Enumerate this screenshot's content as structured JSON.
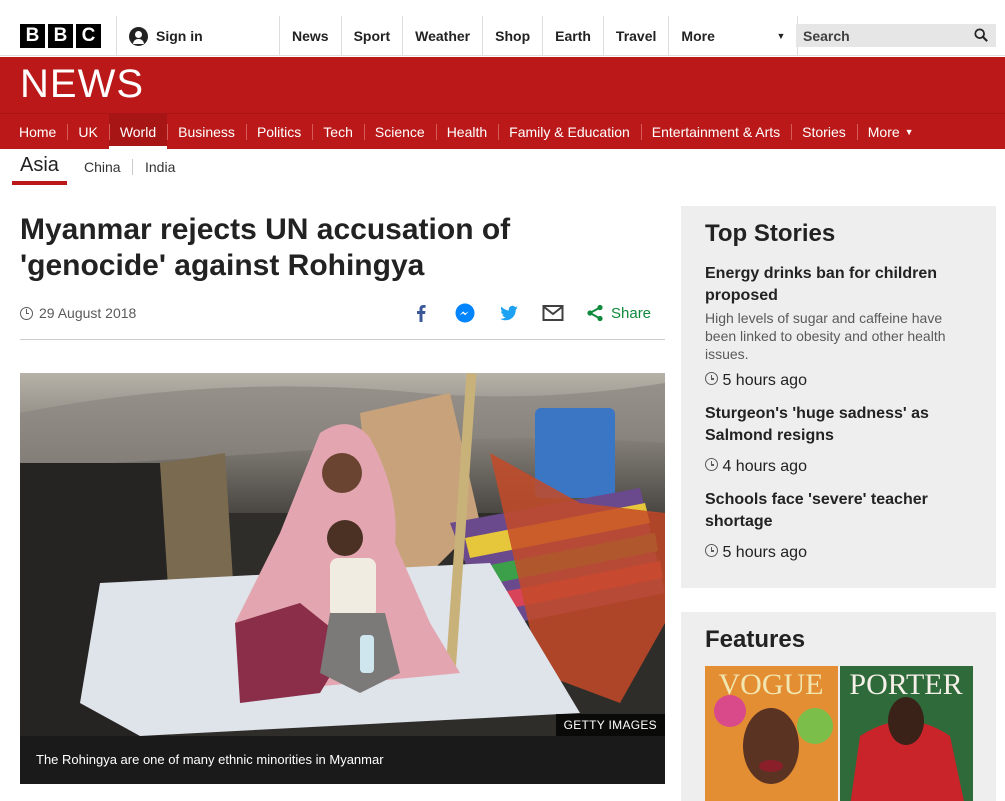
{
  "masthead": {
    "logo_letters": [
      "B",
      "B",
      "C"
    ],
    "signin_label": "Sign in",
    "nav": [
      {
        "label": "News"
      },
      {
        "label": "Sport"
      },
      {
        "label": "Weather"
      },
      {
        "label": "Shop"
      },
      {
        "label": "Earth"
      },
      {
        "label": "Travel"
      },
      {
        "label": "More"
      }
    ],
    "search_placeholder": "Search"
  },
  "banner": {
    "title": "NEWS",
    "color": "#bb1919"
  },
  "section_nav": [
    {
      "label": "Home"
    },
    {
      "label": "UK"
    },
    {
      "label": "World",
      "active": true
    },
    {
      "label": "Business"
    },
    {
      "label": "Politics"
    },
    {
      "label": "Tech"
    },
    {
      "label": "Science"
    },
    {
      "label": "Health"
    },
    {
      "label": "Family & Education"
    },
    {
      "label": "Entertainment & Arts"
    },
    {
      "label": "Stories"
    },
    {
      "label": "More"
    }
  ],
  "subnav": {
    "current": "Asia",
    "links": [
      "China",
      "India"
    ]
  },
  "article": {
    "headline_line1": "Myanmar rejects UN accusation of",
    "headline_line2": "'genocide' against Rohingya",
    "date": "29 August 2018",
    "share_label": "Share",
    "image_credit": "GETTY IMAGES",
    "caption": "The Rohingya are one of many ethnic minorities in Myanmar"
  },
  "top_stories": {
    "title": "Top Stories",
    "items": [
      {
        "headline": "Energy drinks ban for children proposed",
        "summary": "High levels of sugar and caffeine have been linked to obesity and other health issues.",
        "time": "5 hours ago"
      },
      {
        "headline": "Sturgeon's 'huge sadness' as Salmond resigns",
        "summary": "",
        "time": "4 hours ago"
      },
      {
        "headline": "Schools face 'severe' teacher shortage",
        "summary": "",
        "time": "5 hours ago"
      }
    ]
  },
  "features": {
    "title": "Features",
    "images": [
      {
        "label": "VOGUE"
      },
      {
        "label": "PORTER"
      }
    ]
  },
  "icons": {
    "facebook": "facebook-icon",
    "messenger": "messenger-icon",
    "twitter": "twitter-icon",
    "email": "email-icon",
    "share": "share-icon"
  }
}
